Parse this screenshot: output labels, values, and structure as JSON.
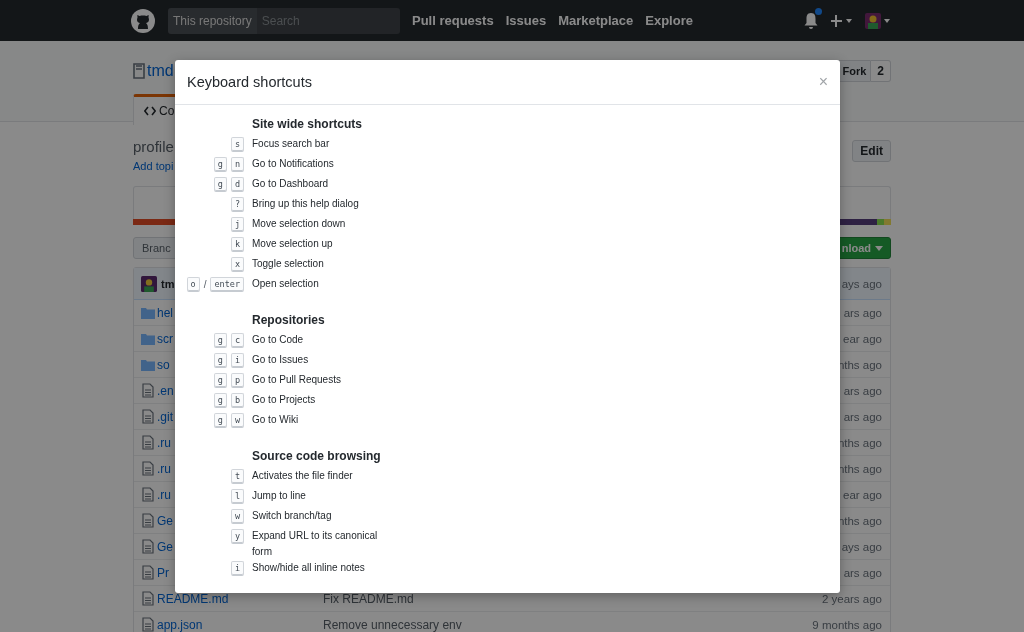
{
  "header": {
    "search_scope": "This repository",
    "search_placeholder": "Search",
    "nav": [
      "Pull requests",
      "Issues",
      "Marketplace",
      "Explore"
    ],
    "has_notification": true
  },
  "repo": {
    "name": "tmd",
    "fork_label": "Fork",
    "fork_count": "2",
    "tab": "Co"
  },
  "about": {
    "description": "profile",
    "add_topic": "Add topi",
    "edit": "Edit"
  },
  "branch_label": "Branc",
  "download_label": "nload",
  "commit": {
    "author": "tm",
    "time": "ays ago"
  },
  "files": [
    {
      "kind": "folder",
      "name": "hel",
      "time": "ars ago"
    },
    {
      "kind": "folder",
      "name": "scr",
      "time": "ear ago"
    },
    {
      "kind": "folder",
      "name": "so",
      "time": "nths ago"
    },
    {
      "kind": "file",
      "name": ".en",
      "time": "ars ago"
    },
    {
      "kind": "file",
      "name": ".git",
      "time": "ars ago"
    },
    {
      "kind": "file",
      "name": ".ru",
      "time": "nths ago"
    },
    {
      "kind": "file",
      "name": ".ru",
      "time": "nths ago"
    },
    {
      "kind": "file",
      "name": ".ru",
      "time": "ear ago"
    },
    {
      "kind": "file",
      "name": "Ge",
      "time": "nths ago"
    },
    {
      "kind": "file",
      "name": "Ge",
      "time": "ays ago"
    },
    {
      "kind": "file",
      "name": "Pr",
      "time": "ars ago"
    },
    {
      "kind": "file",
      "name": "README.md",
      "message": "Fix README.md",
      "time": "2 years ago"
    },
    {
      "kind": "file",
      "name": "app.json",
      "message": "Remove unnecessary env",
      "time": "9 months ago"
    }
  ],
  "modal": {
    "title": "Keyboard shortcuts",
    "close": "×",
    "sections": [
      {
        "title": "Site wide shortcuts",
        "shortcuts": [
          {
            "keys": [
              "s"
            ],
            "description": "Focus search bar"
          },
          {
            "keys": [
              "g",
              "n"
            ],
            "description": "Go to Notifications"
          },
          {
            "keys": [
              "g",
              "d"
            ],
            "description": "Go to Dashboard"
          },
          {
            "keys": [
              "?"
            ],
            "description": "Bring up this help dialog"
          },
          {
            "keys": [
              "j"
            ],
            "description": "Move selection down"
          },
          {
            "keys": [
              "k"
            ],
            "description": "Move selection up"
          },
          {
            "keys": [
              "x"
            ],
            "description": "Toggle selection"
          },
          {
            "keys": [
              "o",
              "enter"
            ],
            "separator": "/",
            "description": "Open selection"
          }
        ]
      },
      {
        "title": "Repositories",
        "shortcuts": [
          {
            "keys": [
              "g",
              "c"
            ],
            "description": "Go to Code"
          },
          {
            "keys": [
              "g",
              "i"
            ],
            "description": "Go to Issues"
          },
          {
            "keys": [
              "g",
              "p"
            ],
            "description": "Go to Pull Requests"
          },
          {
            "keys": [
              "g",
              "b"
            ],
            "description": "Go to Projects"
          },
          {
            "keys": [
              "g",
              "w"
            ],
            "description": "Go to Wiki"
          }
        ]
      },
      {
        "title": "Source code browsing",
        "shortcuts": [
          {
            "keys": [
              "t"
            ],
            "description": "Activates the file finder"
          },
          {
            "keys": [
              "l"
            ],
            "description": "Jump to line"
          },
          {
            "keys": [
              "w"
            ],
            "description": "Switch branch/tag"
          },
          {
            "keys": [
              "y"
            ],
            "description": "Expand URL to its canonical form"
          },
          {
            "keys": [
              "i"
            ],
            "description": "Show/hide all inline notes"
          }
        ]
      }
    ]
  }
}
